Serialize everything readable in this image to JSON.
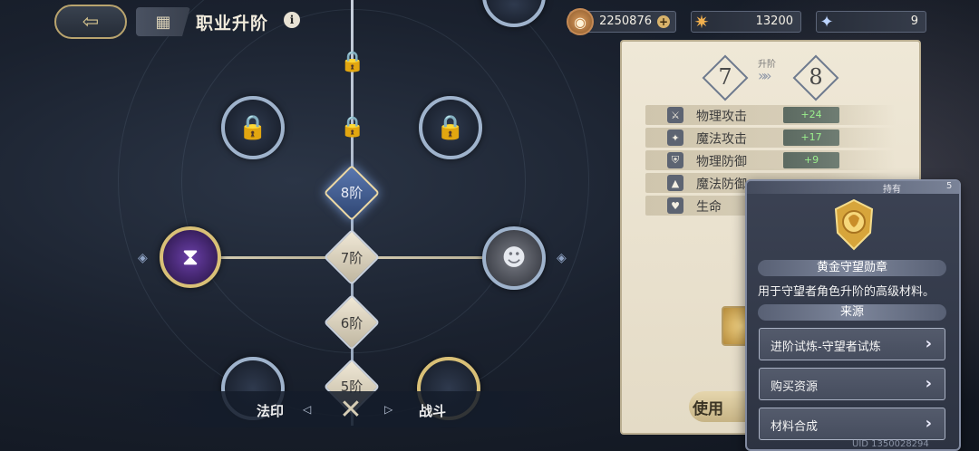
{
  "header": {
    "title": "职业升阶",
    "info_glyph": "i",
    "back_glyph": "⇦",
    "menu_glyph": "▦"
  },
  "resources": {
    "gold": {
      "value": "2250876",
      "icon": "coin-icon",
      "plus": "+"
    },
    "star": {
      "value": "13200",
      "icon": "star-icon"
    },
    "gem": {
      "value": "9",
      "icon": "crystal-icon"
    }
  },
  "tree": {
    "levels": [
      {
        "label": "8阶",
        "active": true
      },
      {
        "label": "7阶",
        "active": false
      },
      {
        "label": "6阶",
        "active": false
      },
      {
        "label": "5阶",
        "active": false
      }
    ],
    "lock_glyph": "🔒"
  },
  "tabs": {
    "left": "法印",
    "right": "战斗",
    "left_arrow": "◁",
    "right_arrow": "▷"
  },
  "upgrade": {
    "from_level": "7",
    "to_level": "8",
    "arrow_label": "升阶",
    "arrows": "»»",
    "stats": [
      {
        "label": "物理攻击",
        "value": "+24",
        "icon": "sword-icon",
        "glyph": "⚔"
      },
      {
        "label": "魔法攻击",
        "value": "+17",
        "icon": "wand-icon",
        "glyph": "✦"
      },
      {
        "label": "物理防御",
        "value": "+9",
        "icon": "shield-icon",
        "glyph": "⛨"
      },
      {
        "label": "魔法防御",
        "value": "",
        "icon": "hat-icon",
        "glyph": "▲"
      },
      {
        "label": "生命",
        "value": "",
        "icon": "heart-icon",
        "glyph": "♥"
      }
    ],
    "use_button": "使用"
  },
  "item": {
    "hold_label": "持有",
    "hold_count": "5",
    "name": "黄金守望勋章",
    "description": "用于守望者角色升阶的高级材料。",
    "source_title": "来源",
    "sources": [
      {
        "label": "进阶试炼-守望者试炼"
      },
      {
        "label": "购买资源"
      },
      {
        "label": "材料合成"
      }
    ],
    "chevron": "›"
  },
  "uid": "UID 1350028294"
}
